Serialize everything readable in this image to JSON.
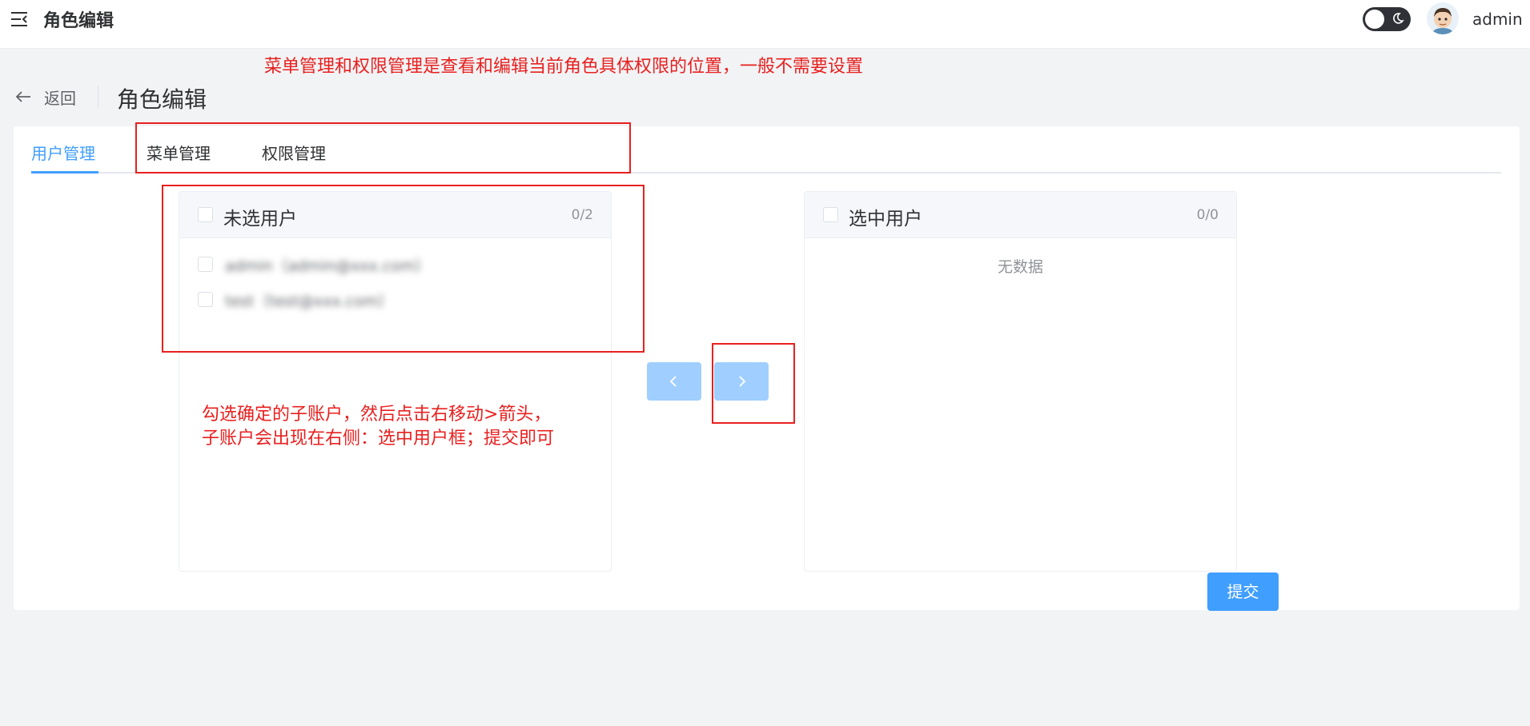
{
  "header": {
    "app_title": "角色编辑",
    "username": "admin"
  },
  "annotations": {
    "top_note": "菜单管理和权限管理是查看和编辑当前角色具体权限的位置，一般不需要设置",
    "body_note_line1": "勾选确定的子账户，然后点击右移动>箭头，",
    "body_note_line2": "子账户会出现在右侧：选中用户框；提交即可"
  },
  "page_header": {
    "back_label": "返回",
    "title": "角色编辑"
  },
  "tabs": [
    {
      "label": "用户管理",
      "active": true
    },
    {
      "label": "菜单管理",
      "active": false
    },
    {
      "label": "权限管理",
      "active": false
    }
  ],
  "transfer": {
    "left_panel": {
      "title": "未选用户",
      "count": "0/2",
      "items": [
        {
          "label": "admin（admin@xxx.com）",
          "checked": false
        },
        {
          "label": "test（test@xxx.com）",
          "checked": false
        }
      ]
    },
    "right_panel": {
      "title": "选中用户",
      "count": "0/0",
      "empty_text": "无数据"
    }
  },
  "actions": {
    "submit_label": "提交"
  },
  "colors": {
    "primary": "#409eff",
    "primary_disabled": "#a0cfff",
    "annotation_red": "#e8201f",
    "page_background": "#f2f3f5"
  }
}
